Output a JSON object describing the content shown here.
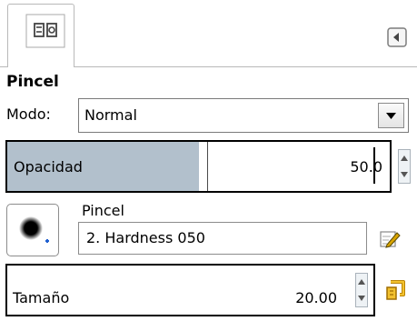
{
  "tool": {
    "title": "Pincel",
    "tab_icon": "tool-options-icon",
    "menu_icon": "tab-menu-arrow-icon"
  },
  "mode": {
    "label": "Modo:",
    "value": "Normal"
  },
  "opacity": {
    "label": "Opacidad",
    "value": "50.0",
    "fill_fraction": 0.5
  },
  "brush": {
    "label": "Pincel",
    "value": "2. Hardness 050",
    "edit_icon": "edit-brush-icon"
  },
  "size": {
    "label": "Tamaño",
    "value": "20.00",
    "reset_icon": "reset-size-icon"
  },
  "colors": {
    "opacity_fill": "#b2c0cc",
    "spin_bg": "#eef2f5",
    "reset_icon": "#e7a800"
  }
}
